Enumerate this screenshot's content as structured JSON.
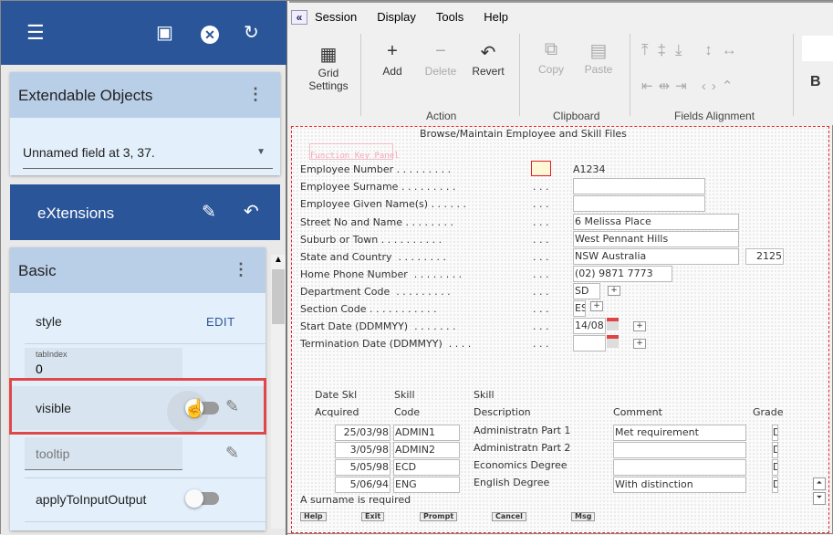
{
  "left": {
    "toolbar": {
      "menu_icon": "menu-icon",
      "save_icon": "save-icon",
      "close_icon": "close-circle-icon",
      "refresh_icon": "refresh-icon"
    },
    "extendable": {
      "title": "Extendable Objects",
      "selected": "Unnamed field at 3, 37."
    },
    "extensions": {
      "title": "eXtensions"
    },
    "basic": {
      "title": "Basic",
      "style_label": "style",
      "edit_label": "EDIT",
      "tabindex_label": "tabIndex",
      "tabindex_value": "0",
      "visible_label": "visible",
      "tooltip_placeholder": "tooltip",
      "apply_label": "applyToInputOutput"
    }
  },
  "menu": [
    "Session",
    "Display",
    "Tools",
    "Help"
  ],
  "ribbon": {
    "grid": "Grid Settings",
    "add": "Add",
    "delete": "Delete",
    "revert": "Revert",
    "copy": "Copy",
    "paste": "Paste",
    "groups": {
      "action": "Action",
      "clipboard": "Clipboard",
      "align": "Fields Alignment"
    },
    "bold": "B"
  },
  "form": {
    "title": "Browse/Maintain Employee and Skill Files",
    "fkpanel": "Function Key Panel",
    "rows": [
      {
        "label": "Employee Number . . . . . . . . .",
        "value": "A1234"
      },
      {
        "label": "Employee Surname . . . . . . . . .",
        "value": ""
      },
      {
        "label": "Employee Given Name(s) . . . . . .",
        "value": ""
      },
      {
        "label": "Street No and Name . . . . . . . .",
        "value": "6 Melissa Place"
      },
      {
        "label": "Suburb or Town . . . . . . . . . .",
        "value": "West Pennant Hills"
      },
      {
        "label": "State and Country  . . . . . . . .",
        "value": "NSW Australia",
        "extra": "2125"
      },
      {
        "label": "Home Phone Number  . . . . . . . .",
        "value": "(02) 9871 7773"
      },
      {
        "label": "Department Code  . . . . . . . . .",
        "value": "SD"
      },
      {
        "label": "Section Code . . . . . . . . . . .",
        "value": "ES"
      },
      {
        "label": "Start Date (DDMMYY)  . . . . . . .",
        "value": "14/08"
      },
      {
        "label": "Termination Date (DDMMYY)  . . . .",
        "value": ""
      }
    ],
    "dots": ". . .",
    "skill_headers": {
      "date1": "Date Skl",
      "date2": "Acquired",
      "code1": "Skill",
      "code2": "Code",
      "desc1": "Skill",
      "desc2": "Description",
      "comment": "Comment",
      "grade": "Grade"
    },
    "skills": [
      {
        "date": "25/03/98",
        "code": "ADMIN1",
        "desc": "Administratn Part 1",
        "comment": "Met requirement",
        "grade": "D"
      },
      {
        "date": "3/05/98",
        "code": "ADMIN2",
        "desc": "Administratn Part 2",
        "comment": "",
        "grade": "D"
      },
      {
        "date": "5/05/98",
        "code": "ECD",
        "desc": "Economics Degree",
        "comment": "",
        "grade": "D"
      },
      {
        "date": "5/06/94",
        "code": "ENG",
        "desc": "English Degree",
        "comment": "With distinction",
        "grade": "D"
      }
    ],
    "message": "A surname is required",
    "fkeys": [
      "Help",
      "Exit",
      "Prompt",
      "Cancel",
      "Msg"
    ]
  }
}
